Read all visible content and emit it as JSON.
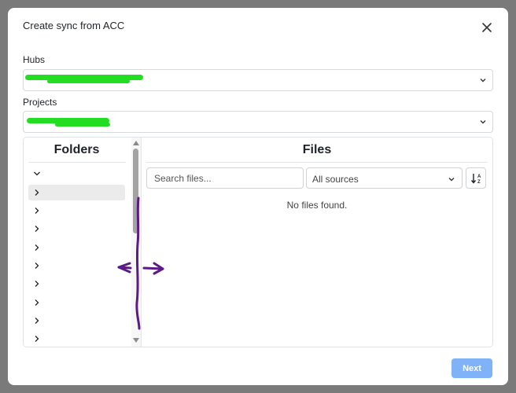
{
  "dialog": {
    "title": "Create sync from ACC",
    "close_icon": "close-icon"
  },
  "hubs": {
    "label": "Hubs",
    "selected_value": "",
    "value_redacted": true
  },
  "projects": {
    "label": "Projects",
    "selected_value": "",
    "value_redacted": true
  },
  "folders": {
    "title": "Folders",
    "items": [
      {
        "expanded": true,
        "selected": false
      },
      {
        "expanded": false,
        "selected": true
      },
      {
        "expanded": false,
        "selected": false
      },
      {
        "expanded": false,
        "selected": false
      },
      {
        "expanded": false,
        "selected": false
      },
      {
        "expanded": false,
        "selected": false
      },
      {
        "expanded": false,
        "selected": false
      },
      {
        "expanded": false,
        "selected": false
      },
      {
        "expanded": false,
        "selected": false
      },
      {
        "expanded": false,
        "selected": false
      }
    ]
  },
  "files": {
    "title": "Files",
    "search_placeholder": "Search files...",
    "source_filter": "All sources",
    "sort_icon": "sort-alpha-icon",
    "empty_message": "No files found."
  },
  "footer": {
    "next_label": "Next"
  },
  "colors": {
    "primary_button": "#7fb2f6",
    "annotation_ink": "#5b1a86",
    "redaction": "#22dd22",
    "backdrop": "#7a7a7a"
  }
}
